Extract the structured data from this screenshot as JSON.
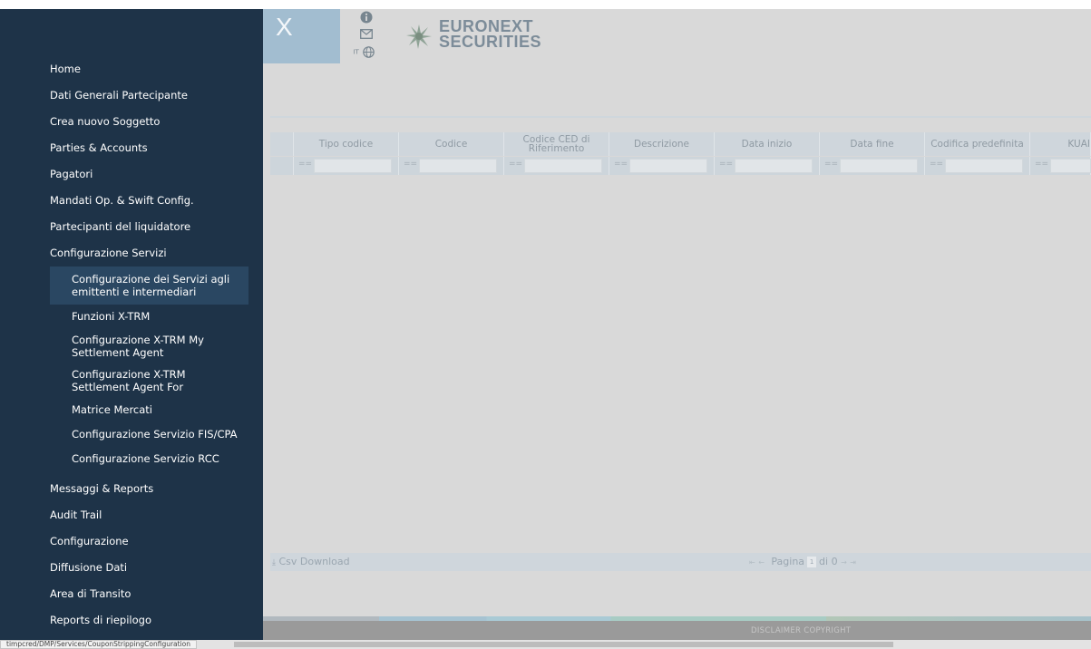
{
  "sidebar": {
    "items": [
      {
        "label": "Home"
      },
      {
        "label": "Dati Generali Partecipante"
      },
      {
        "label": "Crea nuovo Soggetto"
      },
      {
        "label": "Parties & Accounts"
      },
      {
        "label": "Pagatori"
      },
      {
        "label": "Mandati Op. & Swift Config."
      },
      {
        "label": "Partecipanti del liquidatore"
      },
      {
        "label": "Configurazione Servizi"
      }
    ],
    "subitems": [
      {
        "label": "Configurazione dei Servizi agli emittenti e intermediari"
      },
      {
        "label": "Funzioni X-TRM"
      },
      {
        "label": "Configurazione X-TRM My Settlement Agent"
      },
      {
        "label": "Configurazione X-TRM Settlement Agent For"
      },
      {
        "label": "Matrice Mercati"
      },
      {
        "label": "Configurazione Servizio FIS/CPA"
      },
      {
        "label": "Configurazione Servizio RCC"
      }
    ],
    "items_after": [
      {
        "label": "Messaggi & Reports"
      },
      {
        "label": "Audit Trail"
      },
      {
        "label": "Configurazione"
      },
      {
        "label": "Diffusione Dati"
      },
      {
        "label": "Area di Transito"
      },
      {
        "label": "Reports di riepilogo"
      }
    ]
  },
  "header": {
    "logo_letter": "X",
    "brand_line1": "EURONEXT",
    "brand_line2": "SECURITIES",
    "lang_prefix": "IT",
    "icons": [
      "info-icon",
      "mail-icon",
      "globe-icon"
    ]
  },
  "grid": {
    "columns": [
      {
        "label": "Tipo codice"
      },
      {
        "label": "Codice"
      },
      {
        "label": "Codice CED di Riferimento"
      },
      {
        "label": "Descrizione"
      },
      {
        "label": "Data inizio"
      },
      {
        "label": "Data fine"
      },
      {
        "label": "Codifica predefinita"
      },
      {
        "label": "KUAI"
      }
    ],
    "filter_operator": "=="
  },
  "footer": {
    "csv_label": "Csv Download",
    "page_label": "Pagina",
    "page_value": "1",
    "of_label": "di 0"
  },
  "bottom_links": "DISCLAIMER  COPYRIGHT",
  "status_url": "timpcred/DMP/Services/CouponStrippingConfiguration"
}
